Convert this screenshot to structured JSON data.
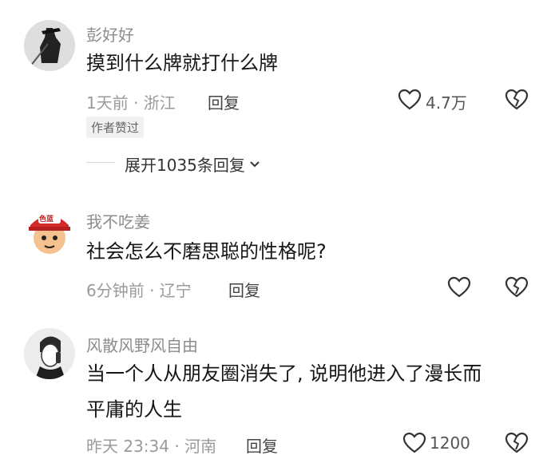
{
  "comments": [
    {
      "username": "彭好好",
      "text_lines": [
        "摸到什么牌就打什么牌"
      ],
      "meta": "1天前 · 浙江",
      "reply_label": "回复",
      "like_count": "4.7万",
      "author_tag": "作者赞过",
      "expand_label": "展开1035条回复"
    },
    {
      "username": "我不吃姜",
      "text_lines": [
        "社会怎么不磨思聪的性格呢?"
      ],
      "meta": "6分钟前 · 辽宁",
      "reply_label": "回复",
      "like_count": ""
    },
    {
      "username": "风散风野风自由",
      "text_lines": [
        "当一个人从朋友圈消失了, 说明他进入了漫长而",
        "平庸的人生"
      ],
      "meta": "昨天 23:34 · 河南",
      "reply_label": "回复",
      "like_count": "1200"
    }
  ],
  "avatar2_badge": "色蓝",
  "colors": {
    "text": "#161616",
    "meta": "#9a9a9a",
    "username": "#8c8c8c"
  }
}
